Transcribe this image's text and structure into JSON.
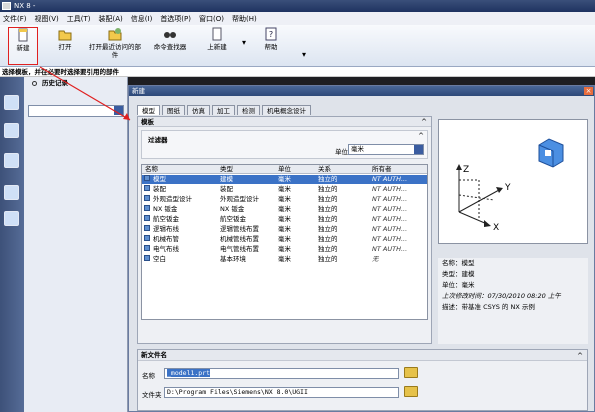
{
  "app": {
    "title": "NX 8 -"
  },
  "menu": [
    "文件(F)",
    "视图(V)",
    "工具(T)",
    "装配(A)",
    "信息(I)",
    "首选项(P)",
    "窗口(O)",
    "帮助(H)"
  ],
  "ribbon": {
    "new": "新建",
    "open": "打开",
    "open_recent": "打开最近访问的部件",
    "command_finder": "命令查找器",
    "prev_new": "上新建",
    "help": "帮助"
  },
  "hint": "选择模板，并在必要时选择要引用的部件",
  "history": {
    "title": "历史记录"
  },
  "dialog": {
    "title": "新建",
    "close": "×",
    "tabs": [
      "模型",
      "图纸",
      "仿真",
      "加工",
      "检测",
      "机电概念设计"
    ],
    "templates_title": "模板",
    "filter_title": "过滤器",
    "units_label": "单位",
    "units_value": "毫米",
    "columns": [
      "名称",
      "类型",
      "单位",
      "关系",
      "所有者"
    ],
    "rows": [
      [
        "模型",
        "建模",
        "毫米",
        "独立的",
        "NT AUTH..."
      ],
      [
        "装配",
        "装配",
        "毫米",
        "独立的",
        "NT AUTH..."
      ],
      [
        "外观造型设计",
        "外观造型设计",
        "毫米",
        "独立的",
        "NT AUTH..."
      ],
      [
        "NX 钣金",
        "NX 钣金",
        "毫米",
        "独立的",
        "NT AUTH..."
      ],
      [
        "航空钣金",
        "航空钣金",
        "毫米",
        "独立的",
        "NT AUTH..."
      ],
      [
        "逻辑布线",
        "逻辑管线布置",
        "毫米",
        "独立的",
        "NT AUTH..."
      ],
      [
        "机械布管",
        "机械管线布置",
        "毫米",
        "独立的",
        "NT AUTH..."
      ],
      [
        "电气布线",
        "电气管线布置",
        "毫米",
        "独立的",
        "NT AUTH..."
      ],
      [
        "空白",
        "基本环境",
        "毫米",
        "独立的",
        "无"
      ]
    ],
    "selected_row": 0,
    "props": {
      "name": "名称：模型",
      "type": "类型：建模",
      "units": "单位：毫米",
      "modified": "上次修改时间：07/30/2010 08:20 上午",
      "desc": "描述：带基准 CSYS 的 NX 示例"
    },
    "new_file_title": "新文件名",
    "name_label": "名称",
    "name_value": "_model1.prt",
    "folder_label": "文件夹",
    "folder_value": "D:\\Program Files\\Siemens\\NX 8.0\\UGII",
    "axis_z": "Z",
    "axis_y": "Y",
    "axis_x": "X"
  }
}
